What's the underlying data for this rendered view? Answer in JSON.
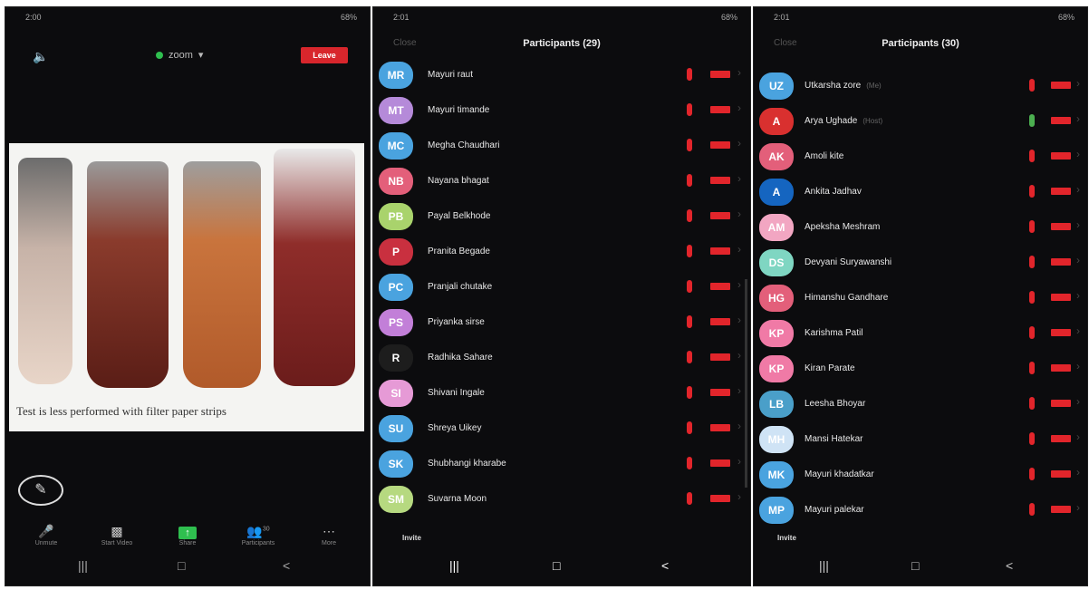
{
  "colors": {
    "leave": "#d8262c",
    "mic_muted": "#e2252b",
    "zoom_green": "#2fbf4f",
    "background": "#0c0c0e"
  },
  "screen1": {
    "status_time": "2:00",
    "status_right": "68%",
    "speaker_icon": "speaker-icon",
    "zoom_label": "zoom",
    "leave_label": "Leave",
    "photo_caption": "Test is less performed with filter paper strips",
    "toolbar": [
      {
        "icon": "mic-icon",
        "label": "Unmute"
      },
      {
        "icon": "video-icon",
        "label": "Start Video"
      },
      {
        "icon": "share-icon",
        "label": "Share"
      },
      {
        "icon": "participants-icon",
        "label": "Participants",
        "count": "30"
      },
      {
        "icon": "more-icon",
        "label": "More"
      }
    ]
  },
  "screen2": {
    "status_time": "2:01",
    "status_right": "68%",
    "close_label": "Close",
    "title": "Participants (29)",
    "invite_label": "Invite",
    "participants": [
      {
        "initials": "MR",
        "name": "Mayuri raut",
        "color": "#4aa3df"
      },
      {
        "initials": "MT",
        "name": "Mayuri timande",
        "color": "#b58ad9"
      },
      {
        "initials": "MC",
        "name": "Megha Chaudhari",
        "color": "#4aa3df"
      },
      {
        "initials": "NB",
        "name": "Nayana bhagat",
        "color": "#e35f7a"
      },
      {
        "initials": "PB",
        "name": "Payal Belkhode",
        "color": "#a9d36c"
      },
      {
        "initials": "P",
        "name": "Pranita Begade",
        "color": "#c9303f"
      },
      {
        "initials": "PC",
        "name": "Pranjali chutake",
        "color": "#4aa3df"
      },
      {
        "initials": "PS",
        "name": "Priyanka sirse",
        "color": "#c27fd8"
      },
      {
        "initials": "R",
        "name": "Radhika Sahare",
        "color": "#1d1d1d"
      },
      {
        "initials": "SI",
        "name": "Shivani Ingale",
        "color": "#e69ad6"
      },
      {
        "initials": "SU",
        "name": "Shreya Uikey",
        "color": "#4aa3df"
      },
      {
        "initials": "SK",
        "name": "Shubhangi kharabe",
        "color": "#4aa3df"
      },
      {
        "initials": "SM",
        "name": "Suvarna Moon",
        "color": "#b6d980"
      }
    ]
  },
  "screen3": {
    "status_time": "2:01",
    "status_right": "68%",
    "close_label": "Close",
    "title": "Participants (30)",
    "invite_label": "Invite",
    "participants": [
      {
        "initials": "UZ",
        "name": "Utkarsha zore",
        "sub": "(Me)",
        "color": "#4aa3df"
      },
      {
        "initials": "A",
        "name": "Arya Ughade",
        "sub": "(Host)",
        "color": "#d9302f"
      },
      {
        "initials": "AK",
        "name": "Amoli kite",
        "color": "#e35f7a"
      },
      {
        "initials": "A",
        "name": "Ankita Jadhav",
        "color": "#1565c0"
      },
      {
        "initials": "AM",
        "name": "Apeksha Meshram",
        "color": "#f2a6c2"
      },
      {
        "initials": "DS",
        "name": "Devyani Suryawanshi",
        "color": "#7fd6c2"
      },
      {
        "initials": "HG",
        "name": "Himanshu Gandhare",
        "color": "#e35f7a"
      },
      {
        "initials": "KP",
        "name": "Karishma Patil",
        "color": "#f07aa6"
      },
      {
        "initials": "KP",
        "name": "Kiran Parate",
        "color": "#f07aa6"
      },
      {
        "initials": "LB",
        "name": "Leesha Bhoyar",
        "color": "#4a9fc9"
      },
      {
        "initials": "MH",
        "name": "Mansi Hatekar",
        "color": "#cfe3f5"
      },
      {
        "initials": "MK",
        "name": "Mayuri khadatkar",
        "color": "#4aa3df"
      },
      {
        "initials": "MP",
        "name": "Mayuri palekar",
        "color": "#4aa3df"
      }
    ]
  }
}
